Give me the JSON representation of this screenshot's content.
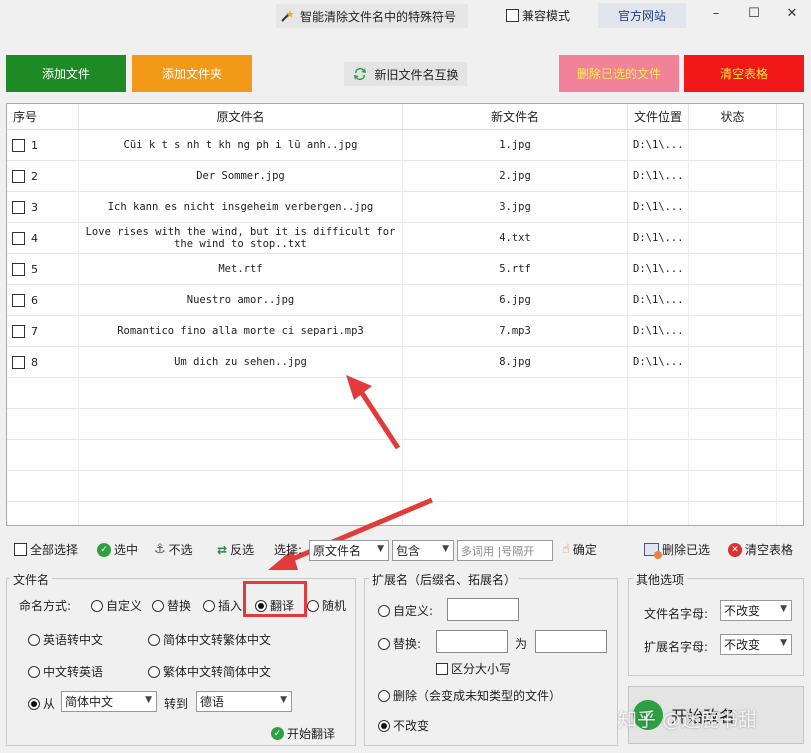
{
  "titlebar": {
    "tool_name": "智能清除文件名中的特殊符号",
    "compat_label": "兼容模式",
    "website_label": "官方网站",
    "min_glyph": "–",
    "max_glyph": "☐",
    "close_glyph": "✕"
  },
  "buttons": {
    "add_file": "添加文件",
    "add_folder": "添加文件夹",
    "swap_names": "新旧文件名互换",
    "delete_selected": "删除已选的文件",
    "clear_table": "清空表格"
  },
  "table": {
    "headers": [
      "序号",
      "原文件名",
      "新文件名",
      "文件位置",
      "状态"
    ],
    "rows": [
      {
        "index": "1",
        "original": "Cũi k t s nh t kh ng ph i lũ anh..jpg",
        "new": "1.jpg",
        "location": "D:\\1\\...",
        "status": ""
      },
      {
        "index": "2",
        "original": "Der Sommer.jpg",
        "new": "2.jpg",
        "location": "D:\\1\\...",
        "status": ""
      },
      {
        "index": "3",
        "original": "Ich kann es nicht insgeheim verbergen..jpg",
        "new": "3.jpg",
        "location": "D:\\1\\...",
        "status": ""
      },
      {
        "index": "4",
        "original": "Love rises with the wind, but it is difficult for the wind to stop..txt",
        "new": "4.txt",
        "location": "D:\\1\\...",
        "status": ""
      },
      {
        "index": "5",
        "original": "Met.rtf",
        "new": "5.rtf",
        "location": "D:\\1\\...",
        "status": ""
      },
      {
        "index": "6",
        "original": "Nuestro amor..jpg",
        "new": "6.jpg",
        "location": "D:\\1\\...",
        "status": ""
      },
      {
        "index": "7",
        "original": "Romantico fino alla morte ci separi.mp3",
        "new": "7.mp3",
        "location": "D:\\1\\...",
        "status": ""
      },
      {
        "index": "8",
        "original": "Um dich zu sehen..jpg",
        "new": "8.jpg",
        "location": "D:\\1\\...",
        "status": ""
      }
    ]
  },
  "toolbar": {
    "select_all": "全部选择",
    "select": "选中",
    "deselect": "不选",
    "invert": "反选",
    "choose_label": "选择:",
    "field_value": "原文件名",
    "match_value": "包含",
    "keyword_placeholder": "多词用 |号隔开",
    "confirm": "确定",
    "delete_checked": "删除已选",
    "clear_table": "清空表格"
  },
  "filename_group": {
    "title": "文件名",
    "mode_label": "命名方式:",
    "modes": [
      "自定义",
      "替换",
      "插入",
      "翻译",
      "随机"
    ],
    "selected_mode": "翻译",
    "options": [
      "英语转中文",
      "简体中文转繁体中文",
      "中文转英语",
      "繁体中文转简体中文"
    ],
    "from_label": "从",
    "from_value": "简体中文",
    "to_label": "转到",
    "to_value": "德语",
    "start_translate": "开始翻译"
  },
  "ext_group": {
    "title": "扩展名（后缀名、拓展名）",
    "custom_label": "自定义:",
    "replace_label": "替换:",
    "to_label": "为",
    "case_sensitive": "区分大小写",
    "delete_label": "删除（会变成未知类型的文件）",
    "no_change": "不改变",
    "selected": "不改变"
  },
  "other_group": {
    "title": "其他选项",
    "filename_case_label": "文件名字母:",
    "filename_case_value": "不改变",
    "ext_case_label": "扩展名字母:",
    "ext_case_value": "不改变"
  },
  "start_button": "开始改名",
  "watermark": "知乎 @迷鹿书甜",
  "colors": {
    "add_file": "#1e8a25",
    "add_folder": "#f29a17",
    "delete_selected": "#f2819a",
    "delete_selected_text": "#ffee55",
    "clear_table": "#f01818",
    "clear_table_text": "#ffee33",
    "highlight": "#e23b3b"
  }
}
